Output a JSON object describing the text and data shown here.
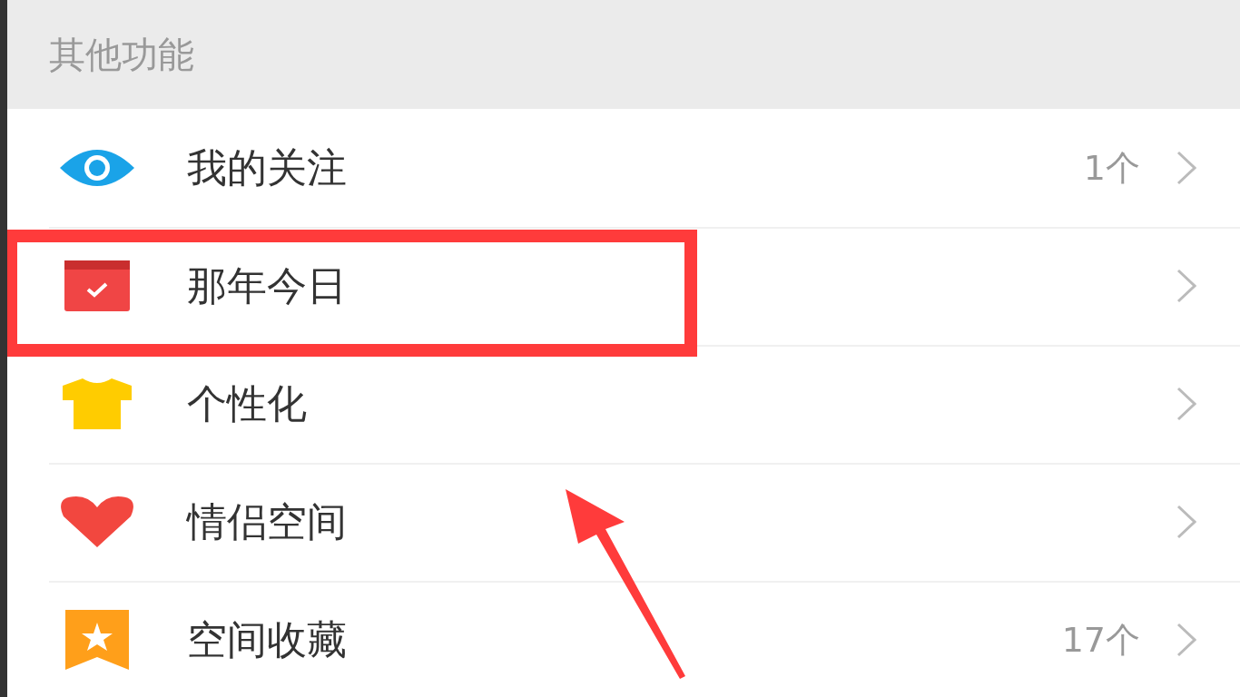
{
  "section": {
    "title": "其他功能"
  },
  "items": [
    {
      "kind": "eye",
      "label": "我的关注",
      "value": "1个",
      "highlighted": false
    },
    {
      "kind": "calendar",
      "label": "那年今日",
      "highlighted": true
    },
    {
      "kind": "shirt",
      "label": "个性化",
      "highlighted": false
    },
    {
      "kind": "heart",
      "label": "情侣空间",
      "highlighted": false
    },
    {
      "kind": "star",
      "label": "空间收藏",
      "value": "17个",
      "highlighted": false
    }
  ],
  "annotation": {
    "arrow": true
  }
}
